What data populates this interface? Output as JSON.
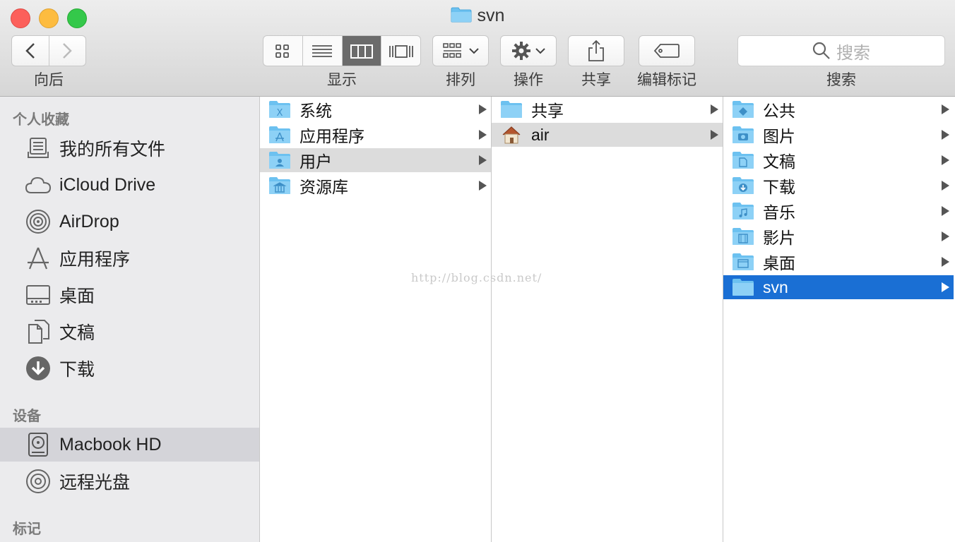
{
  "window": {
    "title": "svn"
  },
  "toolbar": {
    "nav_label": "向后",
    "view_label": "显示",
    "arrange_label": "排列",
    "action_label": "操作",
    "share_label": "共享",
    "tags_label": "编辑标记",
    "search_label": "搜索",
    "search_placeholder": "搜索",
    "active_view": "column"
  },
  "sidebar": {
    "favorites_header": "个人收藏",
    "favorites": [
      {
        "label": "我的所有文件",
        "icon": "all-files-icon"
      },
      {
        "label": "iCloud Drive",
        "icon": "cloud-icon"
      },
      {
        "label": "AirDrop",
        "icon": "airdrop-icon"
      },
      {
        "label": "应用程序",
        "icon": "applications-icon"
      },
      {
        "label": "桌面",
        "icon": "desktop-icon"
      },
      {
        "label": "文稿",
        "icon": "documents-icon"
      },
      {
        "label": "下载",
        "icon": "downloads-icon"
      }
    ],
    "devices_header": "设备",
    "devices": [
      {
        "label": "Macbook HD",
        "icon": "hard-drive-icon",
        "selected": true
      },
      {
        "label": "远程光盘",
        "icon": "disc-icon"
      }
    ],
    "tags_header": "标记"
  },
  "columns": {
    "col1": [
      {
        "label": "系统",
        "icon": "system-folder-icon"
      },
      {
        "label": "应用程序",
        "icon": "applications-folder-icon"
      },
      {
        "label": "用户",
        "icon": "users-folder-icon",
        "selected": "gray"
      },
      {
        "label": "资源库",
        "icon": "library-folder-icon"
      }
    ],
    "col2": [
      {
        "label": "共享",
        "icon": "folder-icon"
      },
      {
        "label": "air",
        "icon": "home-icon",
        "selected": "gray"
      }
    ],
    "col3": [
      {
        "label": "公共",
        "icon": "public-folder-icon"
      },
      {
        "label": "图片",
        "icon": "pictures-folder-icon"
      },
      {
        "label": "文稿",
        "icon": "documents-folder-icon"
      },
      {
        "label": "下载",
        "icon": "downloads-folder-icon"
      },
      {
        "label": "音乐",
        "icon": "music-folder-icon"
      },
      {
        "label": "影片",
        "icon": "movies-folder-icon"
      },
      {
        "label": "桌面",
        "icon": "desktop-folder-icon"
      },
      {
        "label": "svn",
        "icon": "folder-icon",
        "selected": "blue"
      }
    ]
  },
  "watermark": "http://blog.csdn.net/",
  "colors": {
    "selection_blue": "#1a6fd4",
    "folder_blue": "#6cc1f0"
  }
}
